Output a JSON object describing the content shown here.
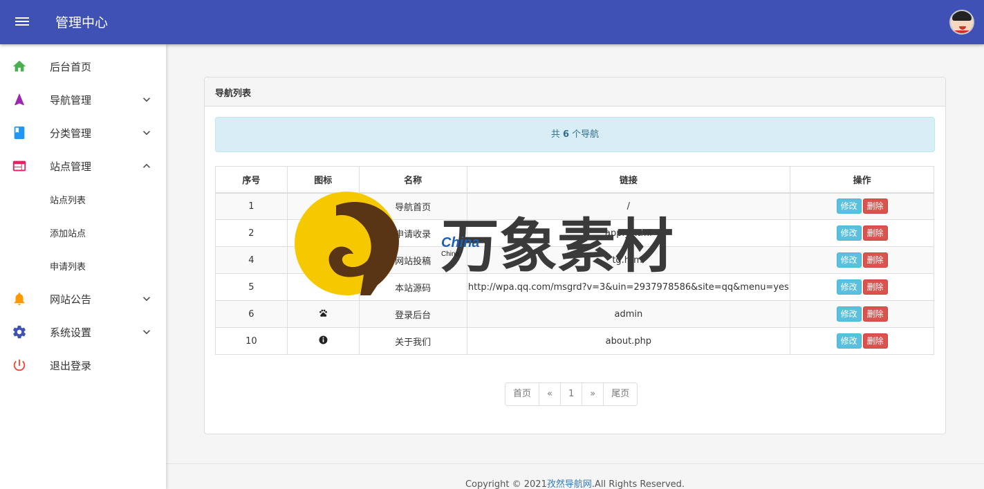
{
  "header": {
    "title": "管理中心"
  },
  "sidebar": {
    "items": [
      {
        "label": "后台首页",
        "icon": "home-icon",
        "color": "#4caf50"
      },
      {
        "label": "导航管理",
        "icon": "navigation-icon",
        "color": "#9c27b0",
        "chevron": "down"
      },
      {
        "label": "分类管理",
        "icon": "book-icon",
        "color": "#2196f3",
        "chevron": "down"
      },
      {
        "label": "站点管理",
        "icon": "web-icon",
        "color": "#e91e63",
        "chevron": "up",
        "subitems": [
          {
            "label": "站点列表"
          },
          {
            "label": "添加站点"
          },
          {
            "label": "申请列表"
          }
        ]
      },
      {
        "label": "网站公告",
        "icon": "bell-icon",
        "color": "#ff9800",
        "chevron": "down"
      },
      {
        "label": "系统设置",
        "icon": "gear-icon",
        "color": "#3f51b5",
        "chevron": "down"
      },
      {
        "label": "退出登录",
        "icon": "power-icon",
        "color": "#f44336"
      }
    ]
  },
  "panel": {
    "title": "导航列表",
    "summary": {
      "prefix": "共",
      "count": "6",
      "suffix": "个导航"
    },
    "columns": [
      "序号",
      "图标",
      "名称",
      "链接",
      "操作"
    ],
    "rows": [
      {
        "id": "1",
        "icon": "",
        "name": "导航首页",
        "link": "/"
      },
      {
        "id": "2",
        "icon": "",
        "name": "申请收录",
        "link": "apply.html"
      },
      {
        "id": "4",
        "icon": "",
        "name": "网站投稿",
        "link": "tg.html"
      },
      {
        "id": "5",
        "icon": "",
        "name": "本站源码",
        "link": "http://wpa.qq.com/msgrd?v=3&uin=2937978586&site=qq&menu=yes"
      },
      {
        "id": "6",
        "icon": "paw-icon",
        "name": "登录后台",
        "link": "admin"
      },
      {
        "id": "10",
        "icon": "info-icon",
        "name": "关于我们",
        "link": "about.php"
      }
    ],
    "actions": {
      "edit": "修改",
      "delete": "删除"
    },
    "pagination": [
      "首页",
      "«",
      "1",
      "»",
      "尾页"
    ]
  },
  "footer": {
    "prefix": "Copyright © 2021",
    "site": "孜然导航网",
    "suffix": ".All Rights Reserved."
  },
  "watermark": {
    "text": "万象素材",
    "brand": "China",
    "sub": "China"
  },
  "colors": {
    "topbar": "#3f51b5",
    "edit": "#5bc0de",
    "delete": "#d9534f",
    "alert_bg": "#d9edf7",
    "alert_text": "#31708f"
  }
}
